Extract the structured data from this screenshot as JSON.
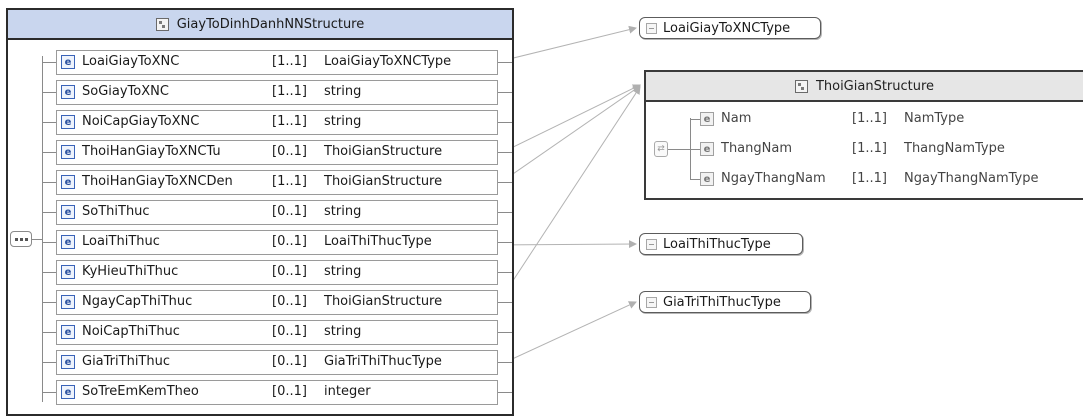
{
  "main_structure": {
    "title": "GiayToDinhDanhNNStructure",
    "elements": [
      {
        "name": "LoaiGiayToXNC",
        "card": "[1..1]",
        "type": "LoaiGiayToXNCType"
      },
      {
        "name": "SoGiayToXNC",
        "card": "[1..1]",
        "type": "string"
      },
      {
        "name": "NoiCapGiayToXNC",
        "card": "[1..1]",
        "type": "string"
      },
      {
        "name": "ThoiHanGiayToXNCTu",
        "card": "[0..1]",
        "type": "ThoiGianStructure"
      },
      {
        "name": "ThoiHanGiayToXNCDen",
        "card": "[1..1]",
        "type": "ThoiGianStructure"
      },
      {
        "name": "SoThiThuc",
        "card": "[0..1]",
        "type": "string"
      },
      {
        "name": "LoaiThiThuc",
        "card": "[0..1]",
        "type": "LoaiThiThucType"
      },
      {
        "name": "KyHieuThiThuc",
        "card": "[0..1]",
        "type": "string"
      },
      {
        "name": "NgayCapThiThuc",
        "card": "[0..1]",
        "type": "ThoiGianStructure"
      },
      {
        "name": "NoiCapThiThuc",
        "card": "[0..1]",
        "type": "string"
      },
      {
        "name": "GiaTriThiThuc",
        "card": "[0..1]",
        "type": "GiaTriThiThucType"
      },
      {
        "name": "SoTreEmKemTheo",
        "card": "[0..1]",
        "type": "integer"
      }
    ]
  },
  "thoigian_structure": {
    "title": "ThoiGianStructure",
    "elements": [
      {
        "name": "Nam",
        "card": "[1..1]",
        "type": "NamType"
      },
      {
        "name": "ThangNam",
        "card": "[1..1]",
        "type": "ThangNamType"
      },
      {
        "name": "NgayThangNam",
        "card": "[1..1]",
        "type": "NgayThangNamType"
      }
    ]
  },
  "simple_types": {
    "loai_giay_to": "LoaiGiayToXNCType",
    "loai_thi_thuc": "LoaiThiThucType",
    "gia_tri_thi_thuc": "GiaTriThiThucType"
  },
  "badge": "e",
  "colors": {
    "title_bar": "#c9d6ee",
    "badge_blue": "#3a63b8",
    "connector": "#a8a8a8"
  },
  "icons": {
    "structure": "structure-icon",
    "sequence": "sequence-icon",
    "choice": "choice-icon",
    "simple_type": "simple-type-icon"
  }
}
